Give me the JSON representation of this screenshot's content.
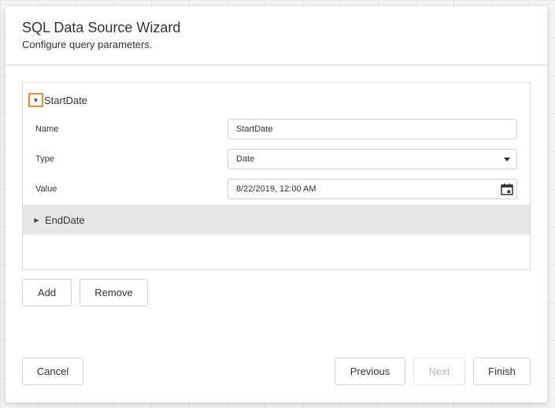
{
  "dialog": {
    "title": "SQL Data Source Wizard",
    "subtitle": "Configure query parameters."
  },
  "parameters": [
    {
      "name": "StartDate",
      "expanded": true,
      "fields": {
        "name_label": "Name",
        "name_value": "StartDate",
        "type_label": "Type",
        "type_value": "Date",
        "value_label": "Value",
        "value_value": "8/22/2019, 12:00 AM"
      }
    },
    {
      "name": "EndDate",
      "expanded": false
    }
  ],
  "icons": {
    "expanded_toggle": "▼",
    "collapsed_toggle": "▶"
  },
  "buttons": {
    "add": "Add",
    "remove": "Remove",
    "cancel": "Cancel",
    "previous": "Previous",
    "next": "Next",
    "finish": "Finish"
  },
  "colors": {
    "focus_accent": "#f08a24",
    "selected_row_bg": "#e6e6e6"
  }
}
